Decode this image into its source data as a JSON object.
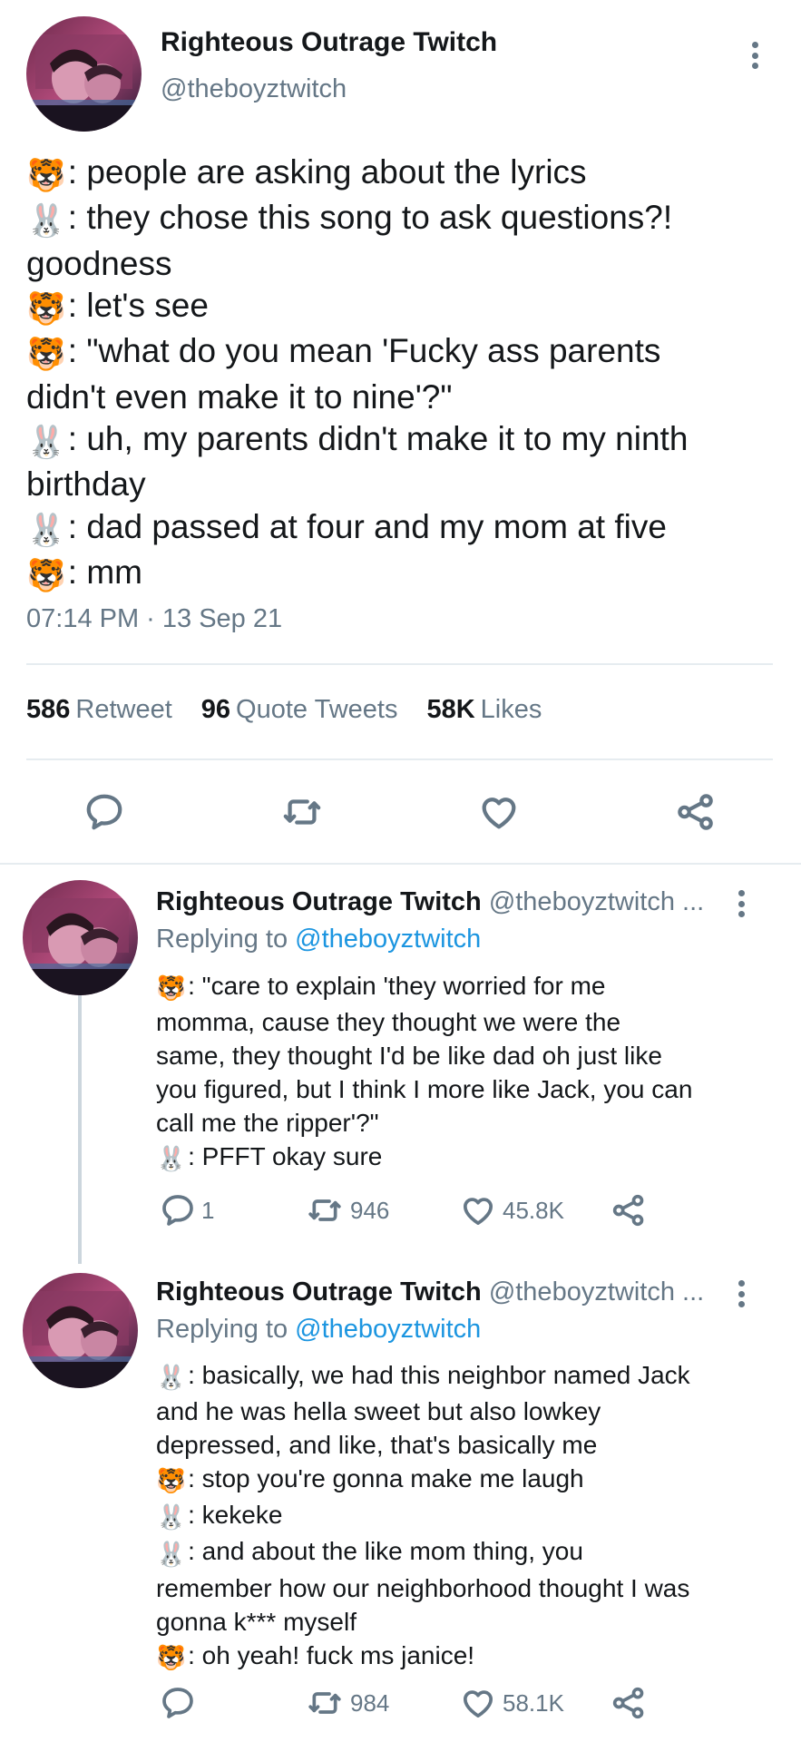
{
  "colors": {
    "text_primary": "#14171a",
    "text_secondary": "#657786",
    "link": "#1b95e0",
    "divider": "#e6ecf0"
  },
  "main_tweet": {
    "author": {
      "name": "Righteous Outrage Twitch",
      "handle": "@theboyztwitch",
      "avatar": "avatar-image"
    },
    "lines": [
      {
        "emoji": "🐯",
        "text": ": people are asking about the lyrics"
      },
      {
        "emoji": "🐰",
        "text": ": they chose this song to ask questions?!\ngoodness"
      },
      {
        "emoji": "🐯",
        "text": ": let's see"
      },
      {
        "emoji": "🐯",
        "text": ": \"what do you mean 'Fucky ass parents\ndidn't even make it to nine'?\""
      },
      {
        "emoji": "🐰",
        "text": ": uh, my parents didn't make it to my ninth\nbirthday"
      },
      {
        "emoji": "🐰",
        "text": ": dad passed at four and my mom at five"
      },
      {
        "emoji": "🐯",
        "text": ": mm"
      }
    ],
    "timestamp": "07:14 PM · 13 Sep 21",
    "stats": {
      "retweets_count": "586",
      "retweets_label": "Retweet",
      "quotes_count": "96",
      "quotes_label": "Quote Tweets",
      "likes_count": "58K",
      "likes_label": "Likes"
    },
    "actions": [
      "reply-icon",
      "retweet-icon",
      "like-icon",
      "share-icon"
    ]
  },
  "replies": [
    {
      "name": "Righteous Outrage Twitch",
      "handle": "@theboyztwitch ...",
      "replying_prefix": "Replying to",
      "replying_to": "@theboyztwitch",
      "lines": [
        {
          "emoji": "🐯",
          "text": ": \"care to explain 'they worried for me\nmomma, cause they thought we were the\nsame, they thought I'd be like dad oh just like\nyou figured, but I think I more like Jack, you can\ncall me the ripper'?\""
        },
        {
          "emoji": "🐰",
          "text": ": PFFT okay sure"
        }
      ],
      "reply_count": "1",
      "retweet_count": "946",
      "like_count": "45.8K"
    },
    {
      "name": "Righteous Outrage Twitch",
      "handle": "@theboyztwitch ...",
      "replying_prefix": "Replying to",
      "replying_to": "@theboyztwitch",
      "lines": [
        {
          "emoji": "🐰",
          "text": ": basically, we had this neighbor named Jack\nand he was hella sweet but also lowkey\ndepressed, and like, that's basically me"
        },
        {
          "emoji": "🐯",
          "text": ": stop you're gonna make me laugh"
        },
        {
          "emoji": "🐰",
          "text": ": kekeke"
        },
        {
          "emoji": "🐰",
          "text": ": and about the like mom thing, you\nremember how our neighborhood thought I was\ngonna k*** myself"
        },
        {
          "emoji": "🐯",
          "text": ": oh yeah! fuck ms janice!"
        }
      ],
      "reply_count": "",
      "retweet_count": "984",
      "like_count": "58.1K"
    }
  ]
}
